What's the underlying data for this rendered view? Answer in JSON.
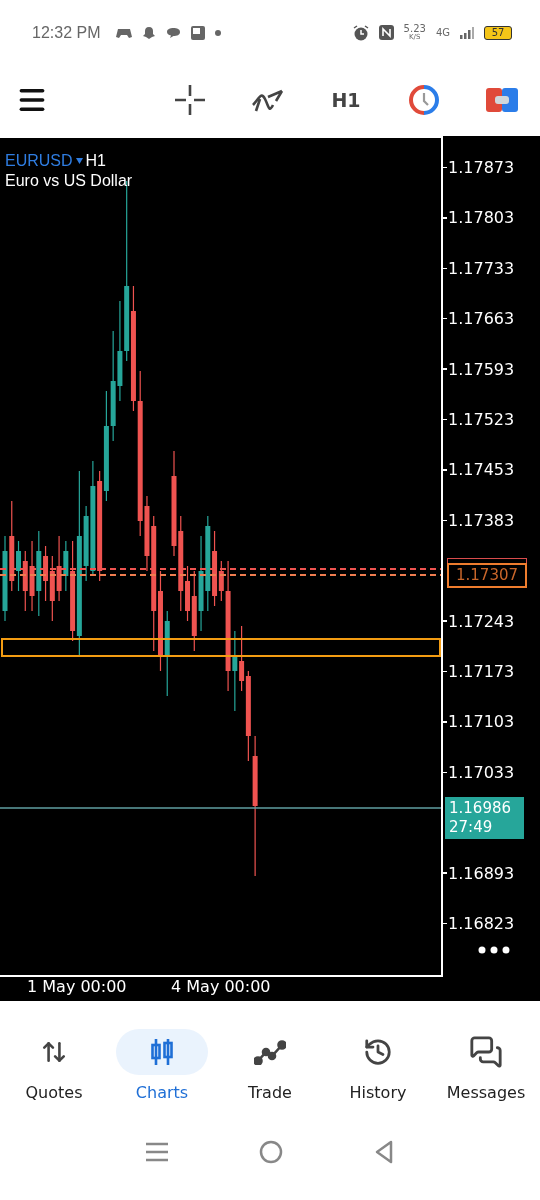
{
  "status_bar": {
    "time": "12:32 PM",
    "net_speed": "5.23",
    "net_speed_unit": "K/S",
    "network": "4G",
    "battery": "57"
  },
  "toolbar": {
    "timeframe": "H1"
  },
  "chart": {
    "symbol": "EURUSD",
    "period": "H1",
    "description": "Euro vs US Dollar",
    "price_labels": [
      "1.17873",
      "1.17803",
      "1.17733",
      "1.17663",
      "1.17593",
      "1.17523",
      "1.17453",
      "1.17383",
      "1.17243",
      "1.17173",
      "1.17103",
      "1.17033",
      "1.16893",
      "1.16823"
    ],
    "marker_price": "1.17307",
    "current": {
      "price": "1.16986",
      "countdown": "27:49"
    },
    "time_labels": [
      "1 May 00:00",
      "4 May 00:00"
    ]
  },
  "nav": [
    {
      "label": "Quotes",
      "selected": false
    },
    {
      "label": "Charts",
      "selected": true
    },
    {
      "label": "Trade",
      "selected": false
    },
    {
      "label": "History",
      "selected": false
    },
    {
      "label": "Messages",
      "selected": false
    }
  ]
}
